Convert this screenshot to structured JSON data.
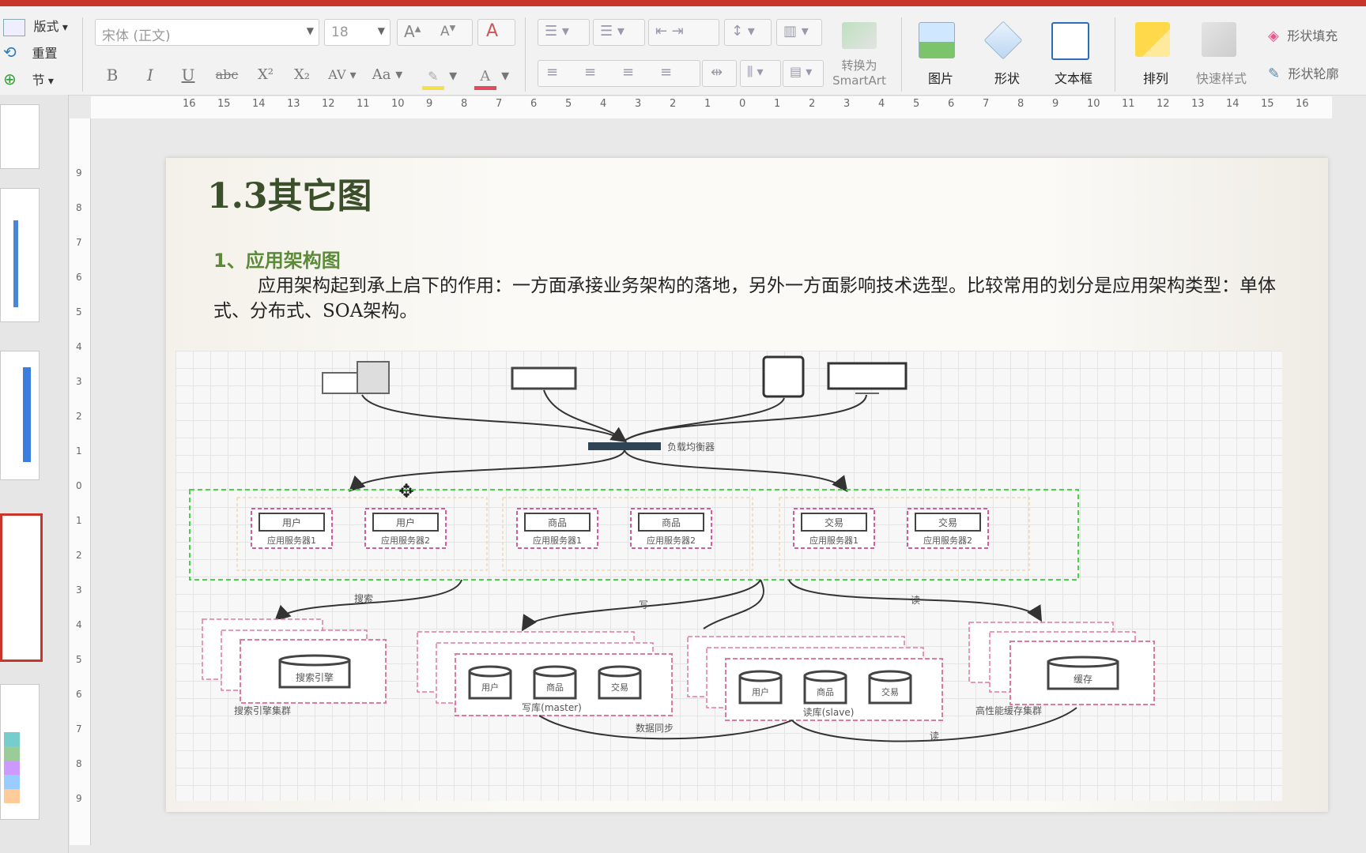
{
  "ribbon": {
    "layout_label": "版式",
    "reset_label": "重置",
    "section_label": "节",
    "font_name_placeholder": "宋体 (正文)",
    "font_size": "18",
    "bold": "B",
    "italic": "I",
    "underline": "U",
    "strikethrough": "abc",
    "superscript": "X²",
    "subscript": "X₂",
    "convert_smartart_line1": "转换为",
    "convert_smartart_line2": "SmartArt",
    "picture_label": "图片",
    "shape_label": "形状",
    "textbox_label": "文本框",
    "arrange_label": "排列",
    "quick_style_label": "快速样式",
    "shape_fill_label": "形状填充",
    "shape_outline_label": "形状轮廓",
    "accent_color": "#c8352b"
  },
  "ruler": {
    "h_ticks": [
      "16",
      "15",
      "14",
      "13",
      "12",
      "11",
      "10",
      "9",
      "8",
      "7",
      "6",
      "5",
      "4",
      "3",
      "2",
      "1",
      "0",
      "1",
      "2",
      "3",
      "4",
      "5",
      "6",
      "7",
      "8",
      "9",
      "10",
      "11",
      "12",
      "13",
      "14",
      "15",
      "16"
    ],
    "v_ticks": [
      "9",
      "8",
      "7",
      "6",
      "5",
      "4",
      "3",
      "2",
      "1",
      "0",
      "1",
      "2",
      "3",
      "4",
      "5",
      "6",
      "7",
      "8",
      "9"
    ]
  },
  "slide": {
    "title": "1.3其它图",
    "subtitle": "1、应用架构图",
    "paragraph": "应用架构起到承上启下的作用：一方面承接业务架构的落地，另外一方面影响技术选型。比较常用的划分是应用架构类型：单体式、分布式、SOA架构。"
  },
  "diagram": {
    "load_balancer": "负载均衡器",
    "services": [
      {
        "top": "用户",
        "bottom": "应用服务器1"
      },
      {
        "top": "用户",
        "bottom": "应用服务器2"
      },
      {
        "top": "商品",
        "bottom": "应用服务器1"
      },
      {
        "top": "商品",
        "bottom": "应用服务器2"
      },
      {
        "top": "交易",
        "bottom": "应用服务器1"
      },
      {
        "top": "交易",
        "bottom": "应用服务器2"
      }
    ],
    "edge_search": "搜索",
    "edge_write": "写",
    "edge_read": "读",
    "search_engine": "搜索引擎",
    "search_cluster": "搜索引擎集群",
    "master_dbs": [
      "用户",
      "商品",
      "交易"
    ],
    "master_label": "写库(master)",
    "slave_dbs": [
      "用户",
      "商品",
      "交易"
    ],
    "slave_label": "读库(slave)",
    "cache": "缓存",
    "cache_cluster": "高性能缓存集群",
    "sync_label": "数据同步",
    "read_label2": "读"
  }
}
